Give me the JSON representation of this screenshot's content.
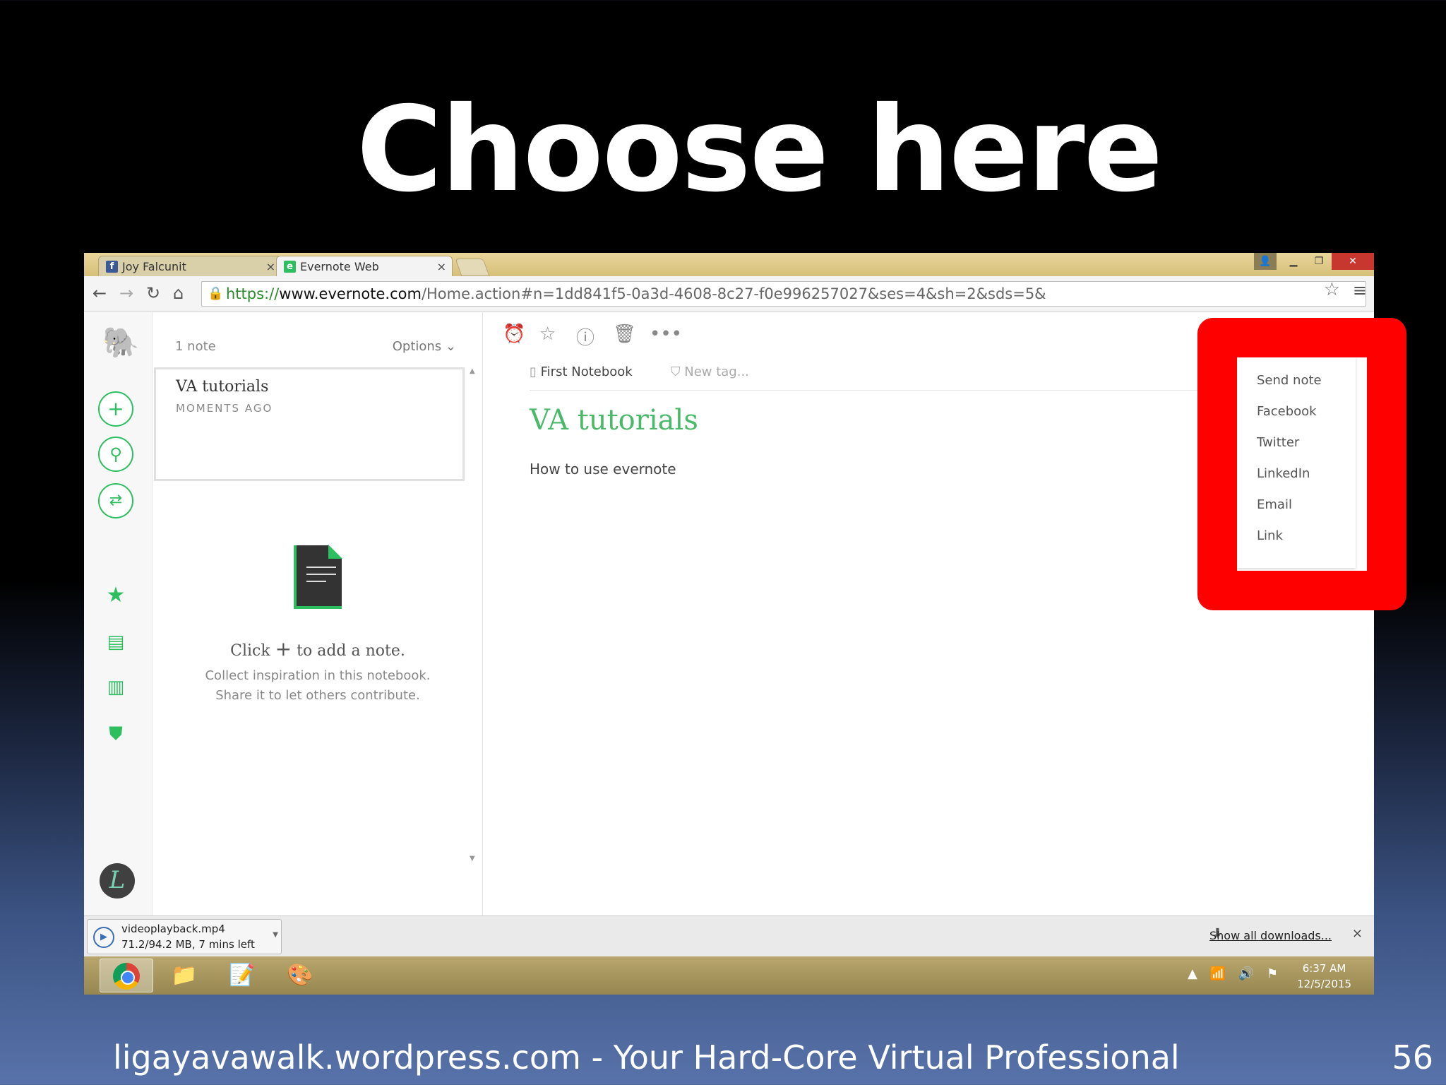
{
  "slide": {
    "title": "Choose here",
    "footer": "ligayavawalk.wordpress.com - Your Hard-Core Virtual Professional",
    "page_number": "56"
  },
  "browser": {
    "tabs": [
      {
        "label": "Joy Falcunit",
        "icon": "facebook-icon",
        "close": "×"
      },
      {
        "label": "Evernote Web",
        "icon": "evernote-icon",
        "close": "×"
      }
    ],
    "url_scheme": "https://",
    "url_host": "www.evernote.com",
    "url_path": "/Home.action#n=1dd841f5-0a3d-4608-8c27-f0e996257027&ses=4&sh=2&sds=5&"
  },
  "notelist": {
    "count": "1 note",
    "options": "Options",
    "notes": [
      {
        "title": "VA tutorials",
        "time": "MOMENTS AGO"
      }
    ],
    "empty_title_pre": "Click",
    "empty_title_post": "to add a note.",
    "empty_line1": "Collect inspiration in this notebook.",
    "empty_line2": "Share it to let others contribute."
  },
  "editor": {
    "notebook": "First Notebook",
    "tag_placeholder": "New tag...",
    "title": "VA tutorials",
    "body": "How to use evernote"
  },
  "share_menu": {
    "items": [
      "Send note",
      "Facebook",
      "Twitter",
      "LinkedIn",
      "Email",
      "Link"
    ]
  },
  "downloads": {
    "file_name": "videoplayback.mp4",
    "progress": "71.2/94.2 MB, 7 mins left",
    "show_all": "Show all downloads...",
    "close": "×"
  },
  "taskbar": {
    "time": "6:37 AM",
    "date": "12/5/2015"
  },
  "colors": {
    "evernote_green": "#2dbe60",
    "highlight_red": "#ff0000"
  }
}
